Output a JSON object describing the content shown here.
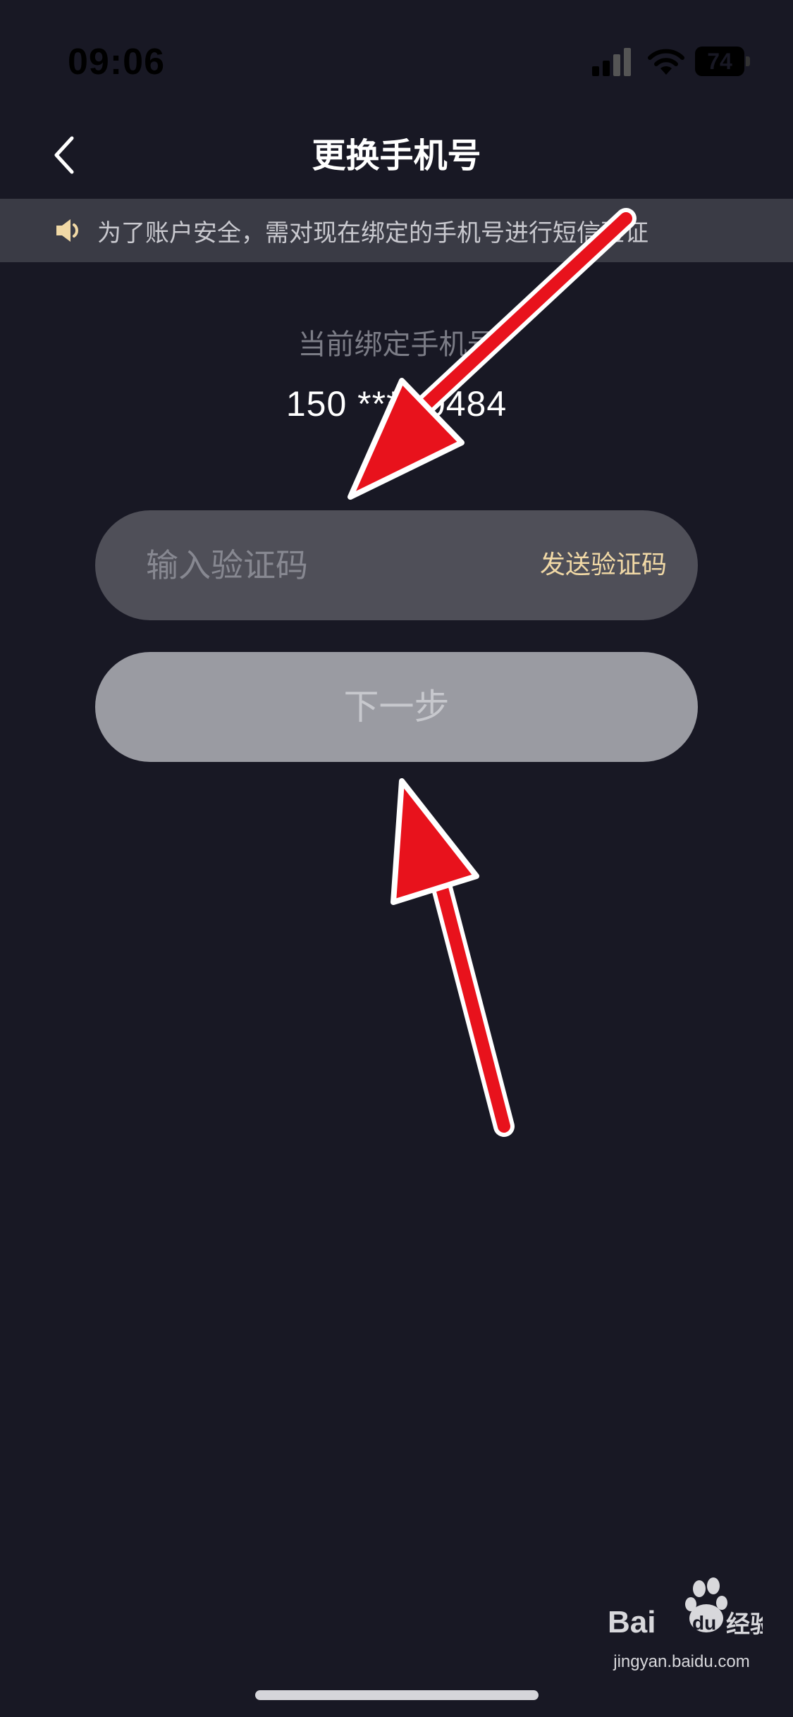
{
  "status_bar": {
    "time": "09:06",
    "battery_level": "74"
  },
  "nav": {
    "title": "更换手机号"
  },
  "notice": {
    "text": "为了账户安全，需对现在绑定的手机号进行短信验证"
  },
  "current_phone": {
    "label": "当前绑定手机号",
    "number": "150 **** 0484"
  },
  "code_input": {
    "placeholder": "输入验证码",
    "send_label": "发送验证码"
  },
  "next_button": {
    "label": "下一步"
  },
  "watermark": {
    "site": "jingyan.baidu.com"
  },
  "colors": {
    "background": "#181824",
    "banner": "#3a3b45",
    "input_bg": "#4f4f58",
    "accent_gold": "#f1d9a6",
    "button_disabled": "#9a9ba2",
    "annotation_red": "#e8121c"
  },
  "icons": {
    "back": "chevron-left-icon",
    "notice": "speaker-icon",
    "signal": "cellular-signal-icon",
    "wifi": "wifi-icon",
    "battery": "battery-icon"
  }
}
